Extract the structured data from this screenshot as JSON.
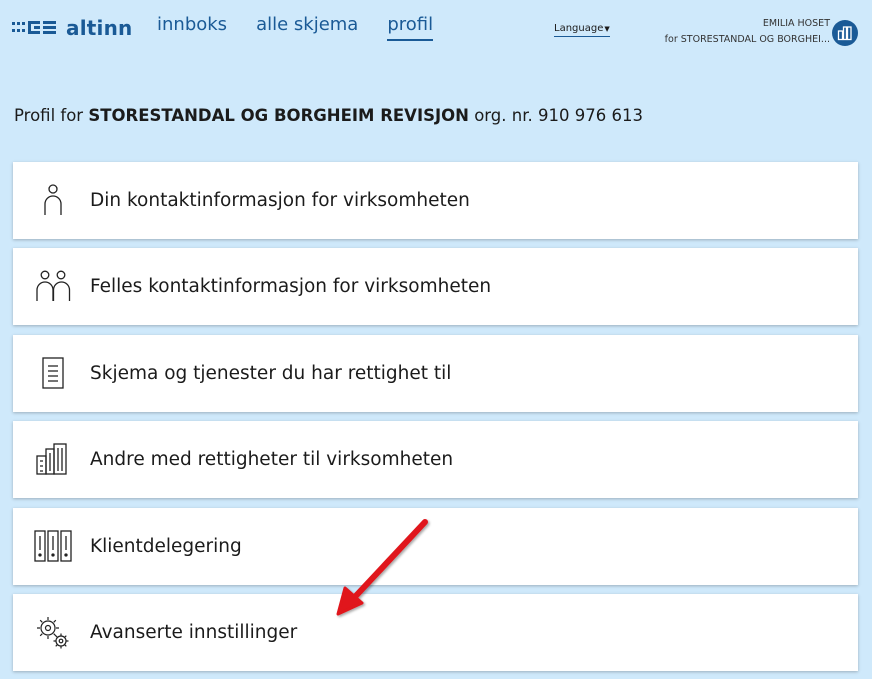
{
  "header": {
    "logo_text": "altinn",
    "nav": [
      {
        "label": "innboks"
      },
      {
        "label": "alle skjema"
      },
      {
        "label": "profil"
      }
    ],
    "language_label": "Language",
    "user_name": "EMILIA HOSET",
    "user_org": "for STORESTANDAL OG BORGHEI..."
  },
  "page": {
    "title_prefix": "Profil for",
    "title_org": "STORESTANDAL OG BORGHEIM REVISJON",
    "title_suffix": "org. nr. 910 976 613"
  },
  "cards": [
    {
      "label": "Din kontaktinformasjon for virksomheten",
      "icon": "person-icon"
    },
    {
      "label": "Felles kontaktinformasjon for virksomheten",
      "icon": "people-icon"
    },
    {
      "label": "Skjema og tjenester du har rettighet til",
      "icon": "document-icon"
    },
    {
      "label": "Andre med rettigheter til virksomheten",
      "icon": "buildings-icon"
    },
    {
      "label": "Klientdelegering",
      "icon": "binders-icon"
    },
    {
      "label": "Avanserte innstillinger",
      "icon": "gears-icon"
    }
  ],
  "colors": {
    "background": "#cfe9fb",
    "brand": "#1a5a96",
    "annotation_arrow": "#e0141a"
  }
}
